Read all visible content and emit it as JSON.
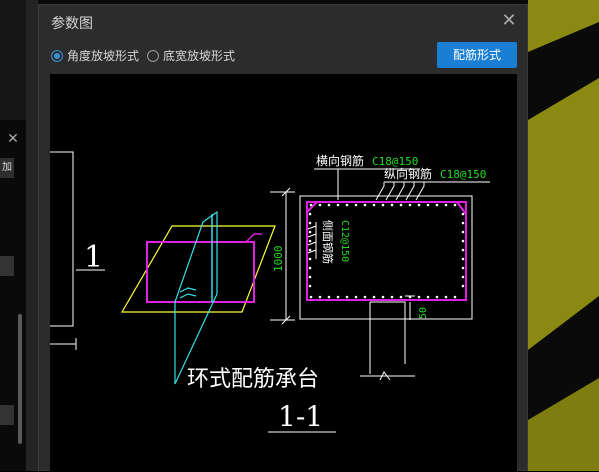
{
  "dialog": {
    "title": "参数图",
    "close_icon": "close-icon"
  },
  "options": {
    "angle_slope": "角度放坡形式",
    "bottom_width_slope": "底宽放坡形式",
    "selected": "angle_slope"
  },
  "config_button": "配筋形式",
  "background": {
    "panel_tab": "加"
  },
  "drawing": {
    "label_1": "1",
    "dim_1000": "1000",
    "transverse_rebar": "横向钢筋",
    "transverse_spec": "C18@150",
    "longitudinal_rebar": "纵向钢筋",
    "longitudinal_spec": "C18@150",
    "side_rebar": "侧面钢筋",
    "side_spec": "C12@150",
    "dim_50": "50",
    "title": "环式配筋承台",
    "section": "1-1"
  },
  "colors": {
    "accent": "#1a7fd4",
    "rebar": "#e020e0",
    "spec_text": "#22dd22",
    "outline": "#ffffff",
    "yellow": "#ffff33",
    "cyan": "#33e0e8",
    "bg_stripe": "#8a8a12"
  }
}
